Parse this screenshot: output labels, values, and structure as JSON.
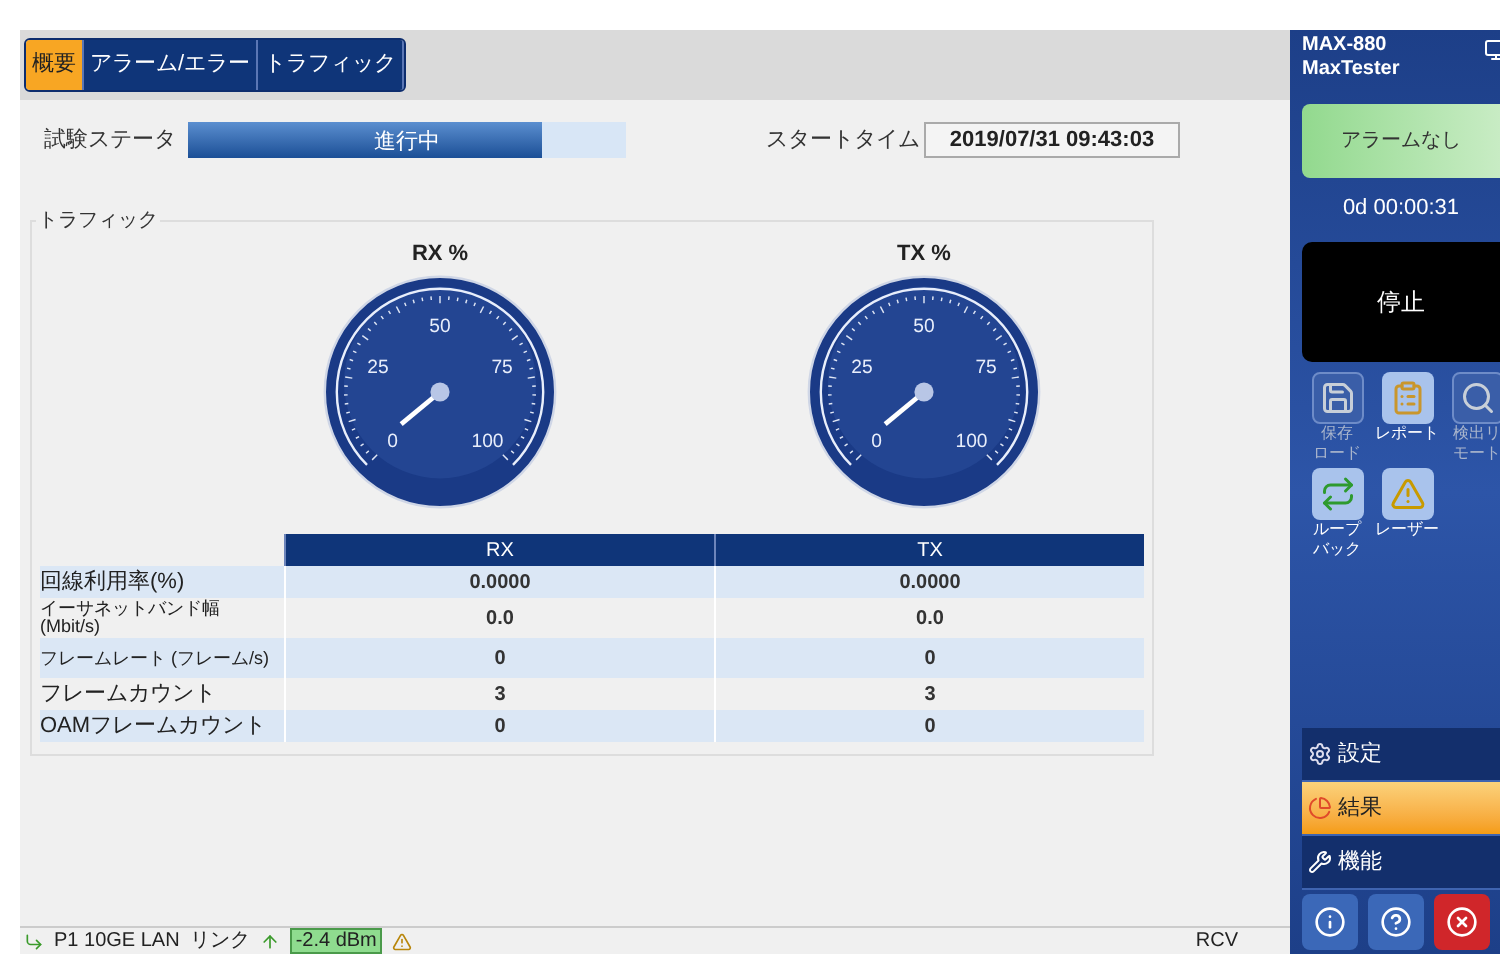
{
  "tabs": [
    {
      "label": "概要",
      "selected": true
    },
    {
      "label": "アラーム/エラー",
      "selected": false
    },
    {
      "label": "トラフィック",
      "selected": false
    }
  ],
  "test_status": {
    "label": "試験ステータ",
    "value": "進行中",
    "level": 0.81
  },
  "start_time": {
    "label": "スタートタイム",
    "value": "2019/07/31 09:43:03"
  },
  "traffic": {
    "title": "トラフィック",
    "gauges": [
      {
        "title": "RX %",
        "scale": [
          "0",
          "25",
          "50",
          "75",
          "100"
        ]
      },
      {
        "title": "TX %",
        "scale": [
          "0",
          "25",
          "50",
          "75",
          "100"
        ]
      }
    ],
    "table": {
      "columns": [
        "RX",
        "TX"
      ],
      "rows": [
        {
          "label": "回線利用率(%)",
          "values": [
            "0.0000",
            "0.0000"
          ]
        },
        {
          "label": "イーサネットバンド幅 (Mbit/s)",
          "values": [
            "0.0",
            "0.0"
          ]
        },
        {
          "label": "フレームレート (フレーム/s)",
          "values": [
            "0",
            "0"
          ]
        },
        {
          "label": "フレームカウント",
          "values": [
            "3",
            "3"
          ]
        },
        {
          "label": "OAMフレームカウント",
          "values": [
            "0",
            "0"
          ]
        }
      ]
    }
  },
  "status_bar": {
    "port": "P1 10GE LAN",
    "link": "リンク",
    "power": "-2.4 dBm",
    "rcv": "RCV"
  },
  "side_panel": {
    "model": "MAX-880",
    "product": "MaxTester",
    "alarm": "アラームなし",
    "elapsed": "0d 00:00:31",
    "stop_button": "停止",
    "tools": [
      {
        "kind": "save",
        "lines": [
          "保存",
          "ロード"
        ],
        "disabled": true
      },
      {
        "kind": "report",
        "lines": [
          "レポート"
        ],
        "disabled": false
      },
      {
        "kind": "discover",
        "lines": [
          "検出リ",
          "モート"
        ],
        "disabled": true
      },
      {
        "kind": "loopback",
        "lines": [
          "ループ",
          "バック"
        ],
        "disabled": false
      },
      {
        "kind": "laser",
        "lines": [
          "レーザー"
        ],
        "disabled": false
      }
    ],
    "menu": [
      {
        "kind": "settings",
        "label": "設定",
        "selected": false
      },
      {
        "kind": "results",
        "label": "結果",
        "selected": true
      },
      {
        "kind": "functions",
        "label": "機能",
        "selected": false
      }
    ]
  }
}
